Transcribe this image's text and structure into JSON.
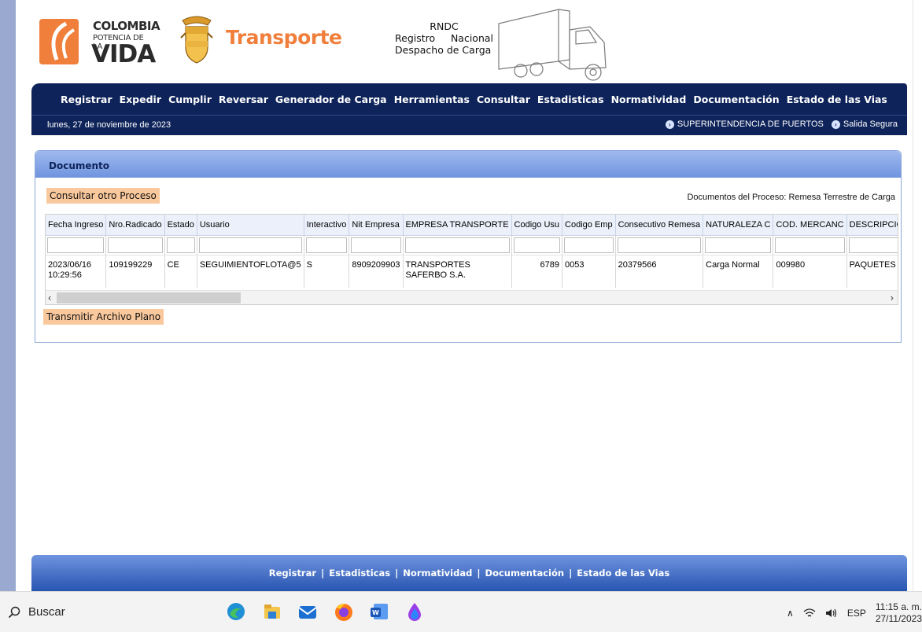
{
  "header": {
    "logo_line1": "COLOMBIA",
    "logo_line2": "POTENCIA DE LA",
    "logo_line3": "VIDA",
    "ministry": "Transporte",
    "rndc_title": "RNDC",
    "rndc_line2_a": "Registro",
    "rndc_line2_b": "Nacional",
    "rndc_line3": "Despacho de Carga"
  },
  "menu": [
    "Registrar",
    "Expedir",
    "Cumplir",
    "Reversar",
    "Generador de Carga",
    "Herramientas",
    "Consultar",
    "Estadisticas",
    "Normatividad",
    "Documentación",
    "Estado de las Vias"
  ],
  "datebar": {
    "date": "lunes, 27 de noviembre de 2023",
    "link1": "SUPERINTENDENCIA DE PUERTOS",
    "link2": "Salida Segura"
  },
  "panel": {
    "title": "Documento",
    "consultar_btn": "Consultar otro Proceso",
    "process_label": "Documentos del Proceso: Remesa Terrestre de Carga",
    "transmitir_btn": "Transmitir Archivo Plano"
  },
  "grid": {
    "columns": [
      "Fecha Ingreso",
      "Nro.Radicado",
      "Estado",
      "Usuario",
      "Interactivo",
      "Nit Empresa",
      "EMPRESA TRANSPORTE",
      "Codigo Usu",
      "Codigo Emp",
      "Consecutivo Remesa",
      "NATURALEZA C",
      "COD. MERCANC",
      "DESCRIPCION CORTA"
    ],
    "row": {
      "fecha": "2023/06/16 10:29:56",
      "radicado": "109199229",
      "estado": "CE",
      "usuario": "SEGUIMIENTOFLOTA@5",
      "interactivo": "S",
      "nit": "8909209903",
      "empresa": "TRANSPORTES SAFERBO S.A.",
      "codigo_usu": "6789",
      "codigo_emp": "0053",
      "consecutivo": "20379566",
      "naturaleza": "Carga Normal",
      "cod_mercancia": "009980",
      "descripcion": "PAQUETES"
    }
  },
  "footer": {
    "links": [
      "Registrar",
      "Estadisticas",
      "Normatividad",
      "Documentación",
      "Estado de las Vias"
    ],
    "separator": "|"
  },
  "taskbar": {
    "search_label": "Buscar",
    "lang": "ESP",
    "time": "11:15 a. m.",
    "date": "27/11/2023"
  },
  "colors": {
    "navy": "#0e2359",
    "orange_brand": "#f07f3c",
    "button_bg": "#f9c89d",
    "panel_header": "#7c9fe3"
  }
}
